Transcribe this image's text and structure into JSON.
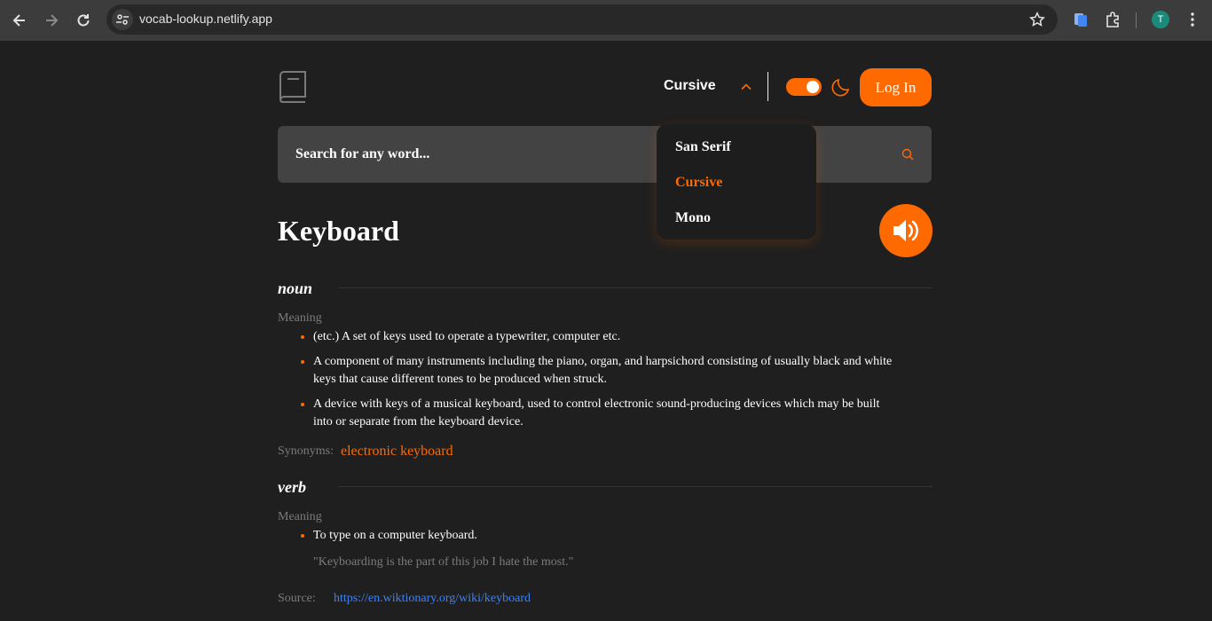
{
  "browser": {
    "url": "vocab-lookup.netlify.app",
    "profile_initial": "T"
  },
  "header": {
    "font_selected": "Cursive",
    "login_label": "Log In"
  },
  "font_dropdown": {
    "options": [
      "San Serif",
      "Cursive",
      "Mono"
    ],
    "active": "Cursive"
  },
  "search": {
    "placeholder": "Search for any word..."
  },
  "entry": {
    "word": "Keyboard",
    "meanings": [
      {
        "part_of_speech": "noun",
        "meaning_label": "Meaning",
        "definitions": [
          "(etc.) A set of keys used to operate a typewriter, computer etc.",
          "A component of many instruments including the piano, organ, and harpsichord consisting of usually black and white keys that cause different tones to be produced when struck.",
          "A device with keys of a musical keyboard, used to control electronic sound-producing devices which may be built into or separate from the keyboard device."
        ],
        "synonyms_label": "Synonyms:",
        "synonyms": [
          "electronic keyboard"
        ]
      },
      {
        "part_of_speech": "verb",
        "meaning_label": "Meaning",
        "definitions": [
          "To type on a computer keyboard."
        ],
        "example": "\"Keyboarding is the part of this job I hate the most.\""
      }
    ],
    "source_label": "Source:",
    "source_url": "https://en.wiktionary.org/wiki/keyboard"
  },
  "colors": {
    "accent": "#ff6a00",
    "background": "#1f1f1f",
    "search_bg": "#434343",
    "muted_text": "#7b7b7b",
    "link": "#3b82f6"
  },
  "icons": {
    "logo": "book-icon",
    "font_chevron": "chevron-up-icon",
    "theme": "moon-icon",
    "search": "search-icon",
    "play": "speaker-icon"
  }
}
